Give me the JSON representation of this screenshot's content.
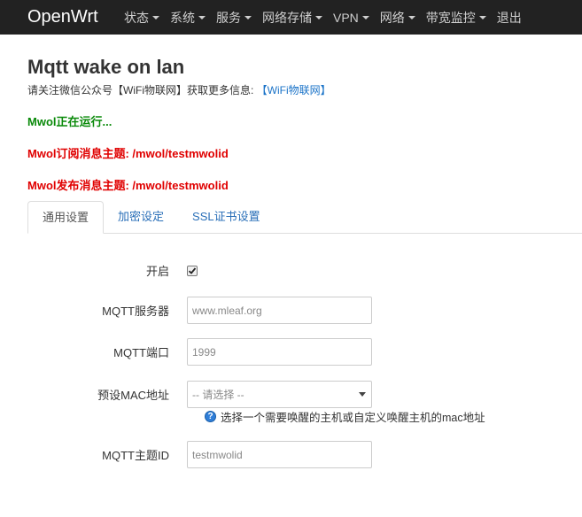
{
  "navbar": {
    "brand": "OpenWrt",
    "items": [
      {
        "label": "状态",
        "dropdown": true
      },
      {
        "label": "系统",
        "dropdown": true
      },
      {
        "label": "服务",
        "dropdown": true
      },
      {
        "label": "网络存储",
        "dropdown": true
      },
      {
        "label": "VPN",
        "dropdown": true
      },
      {
        "label": "网络",
        "dropdown": true
      },
      {
        "label": "带宽监控",
        "dropdown": true
      },
      {
        "label": "退出",
        "dropdown": false
      }
    ]
  },
  "page": {
    "title": "Mqtt wake on lan",
    "subtitle_text": "请关注微信公众号【WiFi物联网】获取更多信息: ",
    "subtitle_link": "【WiFi物联网】",
    "status_running": "Mwol正在运行...",
    "status_subscribe": "Mwol订阅消息主题: /mwol/testmwolid",
    "status_publish": "Mwol发布消息主题: /mwol/testmwolid"
  },
  "tabs": [
    {
      "label": "通用设置",
      "active": true
    },
    {
      "label": "加密设定",
      "active": false
    },
    {
      "label": "SSL证书设置",
      "active": false
    }
  ],
  "form": {
    "enable": {
      "label": "开启",
      "checked": true
    },
    "server": {
      "label": "MQTT服务器",
      "value": "www.mleaf.org"
    },
    "port": {
      "label": "MQTT端口",
      "value": "1999"
    },
    "mac": {
      "label": "预设MAC地址",
      "value": "-- 请选择 --",
      "help": "选择一个需要唤醒的主机或自定义唤醒主机的mac地址"
    },
    "topic_id": {
      "label": "MQTT主题ID",
      "value": "testmwolid"
    }
  },
  "colors": {
    "navbar_bg": "#222222",
    "status_ok": "#0a8a0a",
    "status_info": "#e00000",
    "link": "#1a73c8"
  }
}
